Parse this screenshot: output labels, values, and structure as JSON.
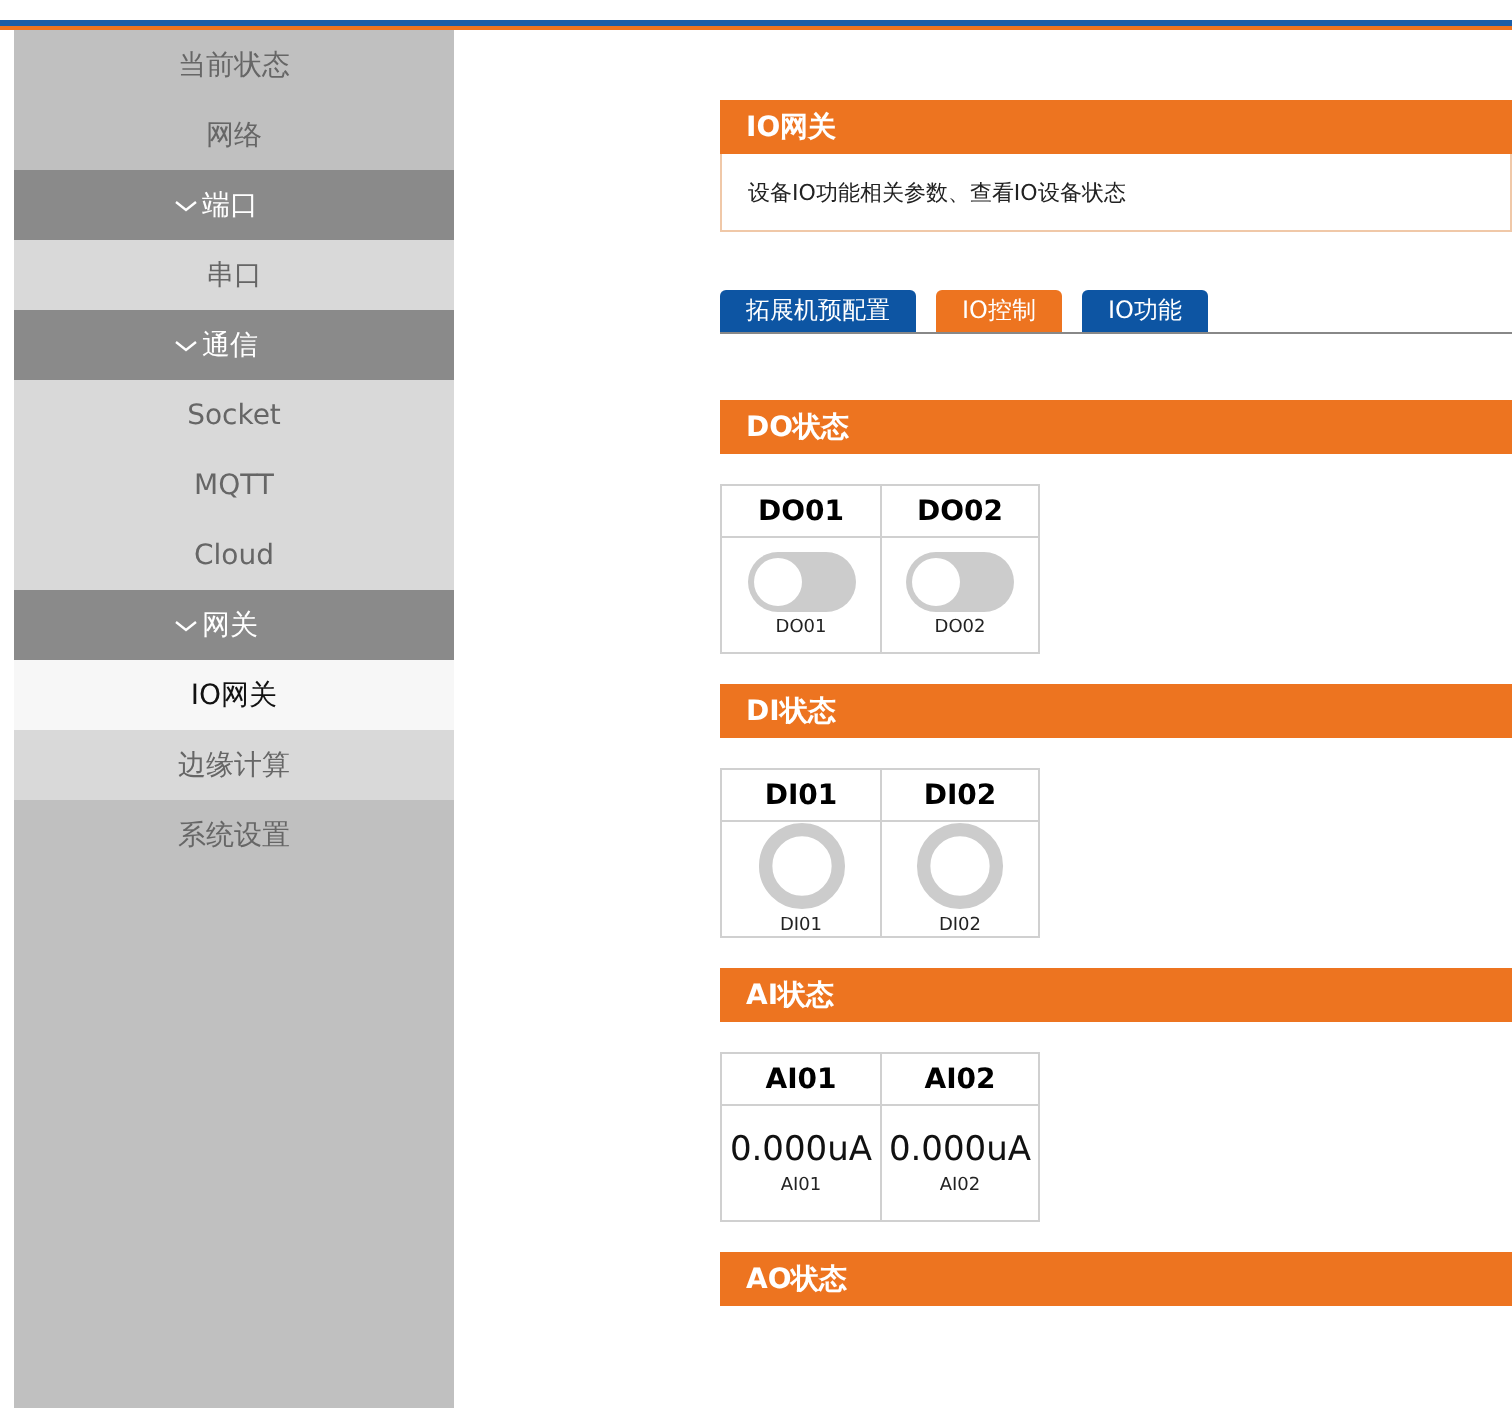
{
  "sidebar": {
    "items": [
      {
        "kind": "item",
        "label": "当前状态",
        "selected": false
      },
      {
        "kind": "item",
        "label": "网络",
        "selected": false
      },
      {
        "kind": "group",
        "label": "端口",
        "expanded": true
      },
      {
        "kind": "subitem",
        "label": "串口",
        "selected": false
      },
      {
        "kind": "group",
        "label": "通信",
        "expanded": true
      },
      {
        "kind": "subitem",
        "label": "Socket",
        "selected": false
      },
      {
        "kind": "subitem",
        "label": "MQTT",
        "selected": false
      },
      {
        "kind": "subitem",
        "label": "Cloud",
        "selected": false
      },
      {
        "kind": "group",
        "label": "网关",
        "expanded": true
      },
      {
        "kind": "subitem",
        "label": "IO网关",
        "selected": true
      },
      {
        "kind": "subitem",
        "label": "边缘计算",
        "selected": false
      },
      {
        "kind": "item",
        "label": "系统设置",
        "selected": false
      }
    ]
  },
  "panel": {
    "title": "IO网关",
    "description": "设备IO功能相关参数、查看IO设备状态"
  },
  "tabs": [
    {
      "label": "拓展机预配置",
      "selected": false
    },
    {
      "label": "IO控制",
      "selected": true
    },
    {
      "label": "IO功能",
      "selected": false
    }
  ],
  "sections": [
    {
      "title": "DO状态",
      "kind": "toggle",
      "channels": [
        {
          "name": "DO01",
          "on": false,
          "label": "DO01"
        },
        {
          "name": "DO02",
          "on": false,
          "label": "DO02"
        }
      ]
    },
    {
      "title": "DI状态",
      "kind": "indicator",
      "channels": [
        {
          "name": "DI01",
          "on": false,
          "label": "DI01"
        },
        {
          "name": "DI02",
          "on": false,
          "label": "DI02"
        }
      ]
    },
    {
      "title": "AI状态",
      "kind": "value",
      "channels": [
        {
          "name": "AI01",
          "value": "0.000uA",
          "label": "AI01"
        },
        {
          "name": "AI02",
          "value": "0.000uA",
          "label": "AI02"
        }
      ]
    },
    {
      "title": "AO状态"
    }
  ]
}
